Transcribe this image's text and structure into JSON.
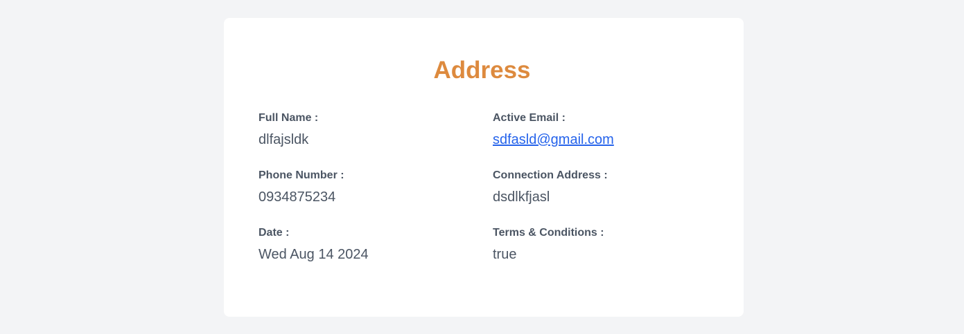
{
  "card": {
    "title": "Address",
    "colors": {
      "title": "#dd8a3e",
      "link": "#2563eb",
      "text": "#4b5563",
      "background": "#f3f4f6",
      "card": "#ffffff"
    }
  },
  "fields": {
    "full_name": {
      "label": "Full Name :",
      "value": "dlfajsldk"
    },
    "active_email": {
      "label": "Active Email :",
      "value": "sdfasld@gmail.com"
    },
    "phone_number": {
      "label": "Phone Number :",
      "value": "0934875234"
    },
    "connection_address": {
      "label": "Connection Address :",
      "value": "dsdlkfjasl"
    },
    "date": {
      "label": "Date :",
      "value": "Wed Aug 14 2024"
    },
    "terms": {
      "label": "Terms & Conditions :",
      "value": "true"
    }
  }
}
